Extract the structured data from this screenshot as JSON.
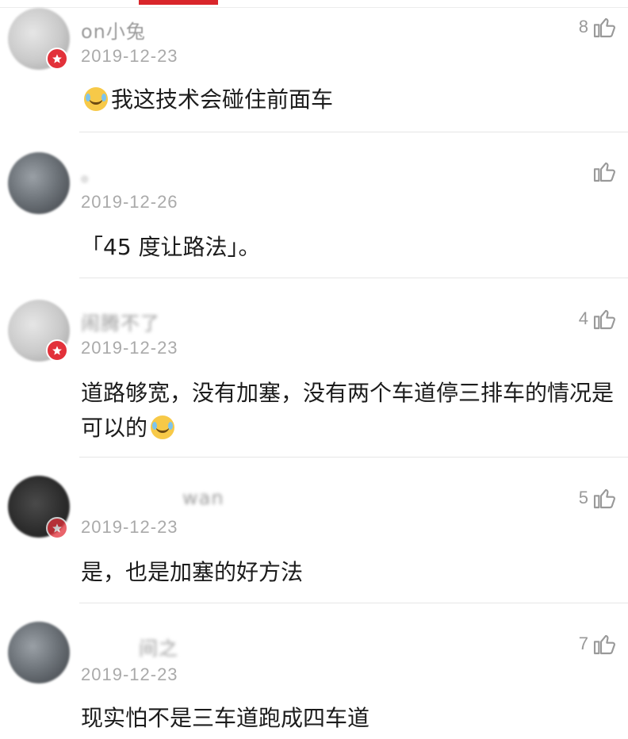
{
  "comments": [
    {
      "username": "on小兔",
      "date": "2019-12-23",
      "likes": "8",
      "text_before_emoji": "",
      "emoji": "laugh-cry-emoji",
      "text": "我这技术会碰住前面车"
    },
    {
      "username": "。",
      "date": "2019-12-26",
      "likes": "",
      "text": "「45 度让路法」。"
    },
    {
      "username": "闹腾不了",
      "date": "2019-12-23",
      "likes": "4",
      "text": "道路够宽，没有加塞，没有两个车道停三排车的情况是可以的",
      "emoji": "laugh-cry-emoji"
    },
    {
      "username": "wan",
      "date": "2019-12-23",
      "likes": "5",
      "text": "是，也是加塞的好方法"
    },
    {
      "username": "间之",
      "date": "2019-12-23",
      "likes": "7",
      "text": "现实怕不是三车道跑成四车道"
    }
  ],
  "colors": {
    "accent": "#d9262b",
    "badge": "#e2313a"
  }
}
